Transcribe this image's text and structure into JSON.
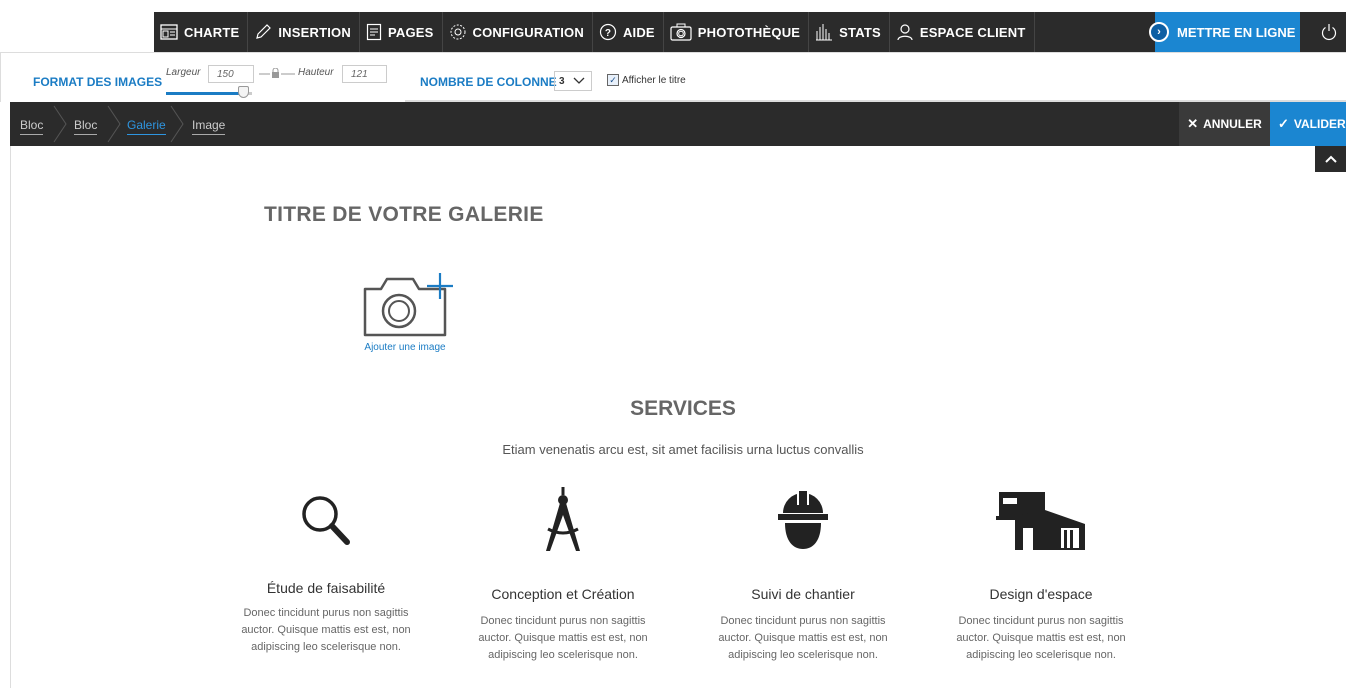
{
  "topbar": {
    "items": [
      {
        "label": "CHARTE",
        "icon": "template-icon"
      },
      {
        "label": "INSERTION",
        "icon": "pencil-icon"
      },
      {
        "label": "PAGES",
        "icon": "pages-icon"
      },
      {
        "label": "CONFIGURATION",
        "icon": "gear-icon"
      },
      {
        "label": "AIDE",
        "icon": "help-icon"
      },
      {
        "label": "PHOTOTHÈQUE",
        "icon": "camera-icon"
      },
      {
        "label": "STATS",
        "icon": "bars-icon"
      },
      {
        "label": "ESPACE CLIENT",
        "icon": "user-icon"
      }
    ],
    "publish_label": "METTRE EN LIGNE"
  },
  "imgbar": {
    "format_label": "FORMAT DES IMAGES",
    "largeur_label": "Largeur",
    "largeur_value": "150",
    "hauteur_label": "Hauteur",
    "hauteur_value": "121",
    "columns_label": "NOMBRE DE COLONNE",
    "columns_value": "3",
    "show_title_label": "Afficher le titre",
    "show_title_checked": true
  },
  "breadcrumb": {
    "items": [
      "Bloc",
      "Bloc",
      "Galerie",
      "Image"
    ],
    "cancel_label": "ANNULER",
    "validate_label": "VALIDER"
  },
  "gallery": {
    "title": "TITRE DE VOTRE GALERIE",
    "add_image_label": "Ajouter une image"
  },
  "services": {
    "title": "SERVICES",
    "subtitle": "Etiam venenatis arcu est, sit amet facilisis urna luctus convallis",
    "items": [
      {
        "name": "Étude de faisabilité",
        "desc": "Donec tincidunt purus non sagittis auctor. Quisque mattis est est, non adipiscing leo scelerisque non.",
        "icon": "magnifier-icon"
      },
      {
        "name": "Conception et Création",
        "desc": "Donec tincidunt purus non sagittis auctor. Quisque mattis est est, non adipiscing leo scelerisque non.",
        "icon": "compass-icon"
      },
      {
        "name": "Suivi de chantier",
        "desc": "Donec tincidunt purus non sagittis auctor. Quisque mattis est est, non adipiscing leo scelerisque non.",
        "icon": "helmet-icon"
      },
      {
        "name": "Design d'espace",
        "desc": "Donec tincidunt purus non sagittis auctor. Quisque mattis est est, non adipiscing leo scelerisque non.",
        "icon": "building-icon"
      }
    ]
  },
  "colors": {
    "accent": "#1b86d1",
    "dark": "#2b2b2b"
  }
}
